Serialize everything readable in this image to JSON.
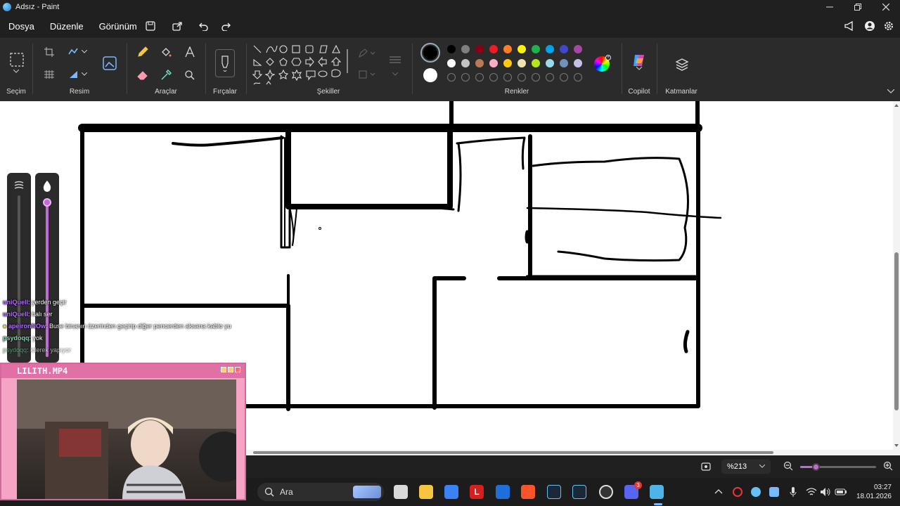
{
  "window": {
    "title": "Adsız - Paint"
  },
  "menu": {
    "file": "Dosya",
    "edit": "Düzenle",
    "view": "Görünüm"
  },
  "ribbon": {
    "groups": {
      "selection": "Seçim",
      "image": "Resim",
      "tools": "Araçlar",
      "brushes": "Fırçalar",
      "shapes": "Şekiller",
      "colors": "Renkler",
      "copilot": "Copilot",
      "layers": "Katmanlar"
    },
    "palette_row1": [
      "#000000",
      "#7f7f7f",
      "#880015",
      "#ed1c24",
      "#ff7f27",
      "#fff200",
      "#22b14c",
      "#00a2e8",
      "#3f48cc",
      "#a349a4"
    ],
    "palette_row2": [
      "#ffffff",
      "#c3c3c3",
      "#b97a57",
      "#ffaec9",
      "#ffc90e",
      "#efe4b0",
      "#b5e61d",
      "#99d9ea",
      "#7092be",
      "#c8bfe7"
    ],
    "primary_color": "#000000",
    "secondary_color": "#ffffff"
  },
  "chat": [
    {
      "user": "uniQuell",
      "user_color": "#b06cff",
      "message": ": yerden geçir"
    },
    {
      "user": "uniQuell",
      "user_color": "#b06cff",
      "message": ": halı ser"
    },
    {
      "user": "apeironNOw",
      "user_color": "#b06cff",
      "message": ": Buse binanın üzerinden geçirip diğer pencerden aksana kablo yu"
    },
    {
      "user": "psydoqq",
      "user_color": "#7bd8a8",
      "message": ": yok"
    },
    {
      "user": "psydoqq",
      "user_color": "#7bd8a8",
      "message": ": kilerek yapıyor"
    }
  ],
  "webcam": {
    "title": "LILITH.MP4"
  },
  "status": {
    "zoom": "%213",
    "zoom_level": 0.2
  },
  "taskbar": {
    "search_placeholder": "Ara",
    "time": "03:27",
    "date": "18.01.2026",
    "discord_badge": "3"
  }
}
